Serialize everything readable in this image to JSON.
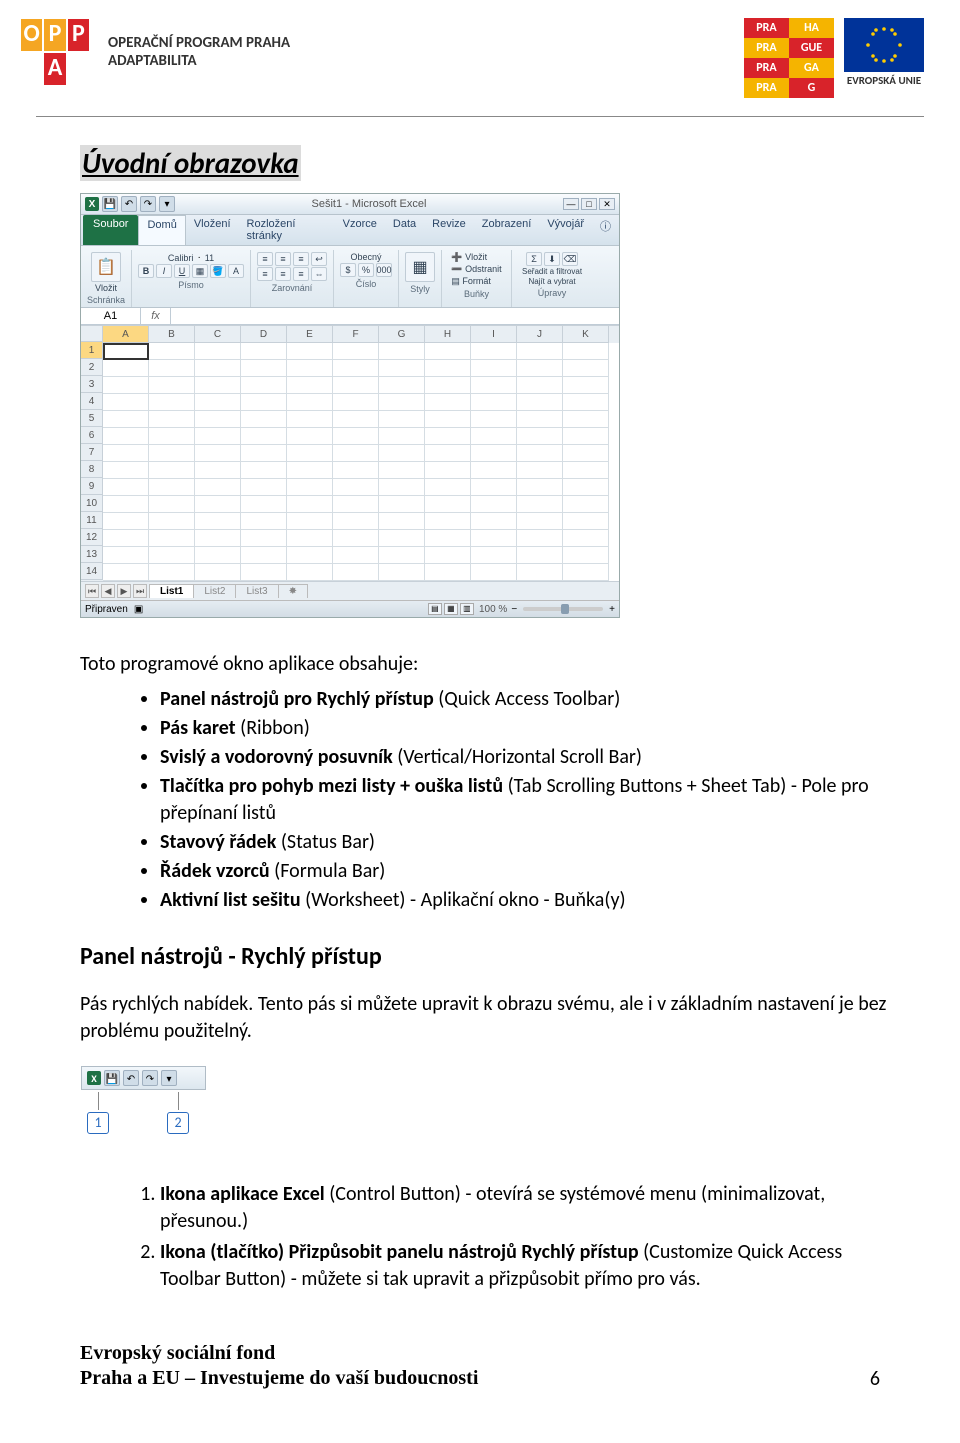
{
  "header": {
    "oppa_letters": [
      "O",
      "P",
      "P",
      "A"
    ],
    "oppa_text_line1": "OPERAČNÍ PROGRAM PRAHA",
    "oppa_text_line2": "ADAPTABILITA",
    "praha_cells": [
      "PRA",
      "HA",
      "PRA",
      "GUE",
      "PRA",
      "GA",
      "PRA",
      "G"
    ],
    "eu_label": "EVROPSKÁ UNIE"
  },
  "section_title": "Úvodní obrazovka",
  "excel": {
    "title": "Sešit1 - Microsoft Excel",
    "tabs": {
      "file": "Soubor",
      "list": [
        "Domů",
        "Vložení",
        "Rozložení stránky",
        "Vzorce",
        "Data",
        "Revize",
        "Zobrazení",
        "Vývojář"
      ]
    },
    "ribbon": {
      "paste": "Vložit",
      "clipboard_label": "Schránka",
      "font_name": "Calibri",
      "font_size": "11",
      "font_label": "Písmo",
      "align_label": "Zarovnání",
      "number_format": "Obecný",
      "number_label": "Číslo",
      "styles_label": "Styly",
      "insert_cell": "Vložit",
      "delete_cell": "Odstranit",
      "format_cell": "Formát",
      "cells_label": "Buňky",
      "sort": "Seřadit a filtrovat",
      "find": "Najít a vybrat",
      "edit_label": "Úpravy"
    },
    "namebox": "A1",
    "fx": "fx",
    "columns": [
      "A",
      "B",
      "C",
      "D",
      "E",
      "F",
      "G",
      "H",
      "I",
      "J",
      "K"
    ],
    "rows": [
      1,
      2,
      3,
      4,
      5,
      6,
      7,
      8,
      9,
      10,
      11,
      12,
      13,
      14
    ],
    "sheets": [
      "List1",
      "List2",
      "List3"
    ],
    "status_ready": "Připraven",
    "zoom": "100 %"
  },
  "intro": "Toto programové okno aplikace obsahuje:",
  "bullets": [
    {
      "bold": "Panel nástrojů pro Rychlý přístup",
      "rest": " (Quick Access Toolbar)"
    },
    {
      "bold": "Pás karet",
      "rest": " (Ribbon)"
    },
    {
      "bold": "Svislý a vodorovný posuvník",
      "rest": " (Vertical/Horizontal Scroll Bar)"
    },
    {
      "bold": "Tlačítka pro pohyb mezi listy + ouška listů",
      "rest": " (Tab Scrolling Buttons + Sheet Tab) - Pole pro přepínaní listů"
    },
    {
      "bold": "Stavový řádek",
      "rest": " (Status Bar)"
    },
    {
      "bold": "Řádek vzorců",
      "rest": " (Formula Bar)"
    },
    {
      "bold": "Aktivní list sešitu",
      "rest": " (Worksheet) - Aplikační okno - Buňka(y)"
    }
  ],
  "sub_heading": "Panel nástrojů - Rychlý přístup",
  "para": "Pás rychlých nabídek. Tento pás si můžete upravit k obrazu svému, ale i v základním nastavení je bez problému použitelný.",
  "callout_nums": [
    "1",
    "2"
  ],
  "numbered": [
    {
      "bold": "Ikona aplikace Excel",
      "rest": " (Control Button) - otevírá se systémové menu (minimalizovat, přesunou.)"
    },
    {
      "bold": "Ikona (tlačítko) Přizpůsobit panelu nástrojů Rychlý přístup",
      "rest": " (Customize Quick Access Toolbar Button) - můžete si tak upravit a přizpůsobit přímo pro vás."
    }
  ],
  "footer": {
    "line1": "Evropský sociální fond",
    "line2": "Praha a EU – Investujeme do vaší budoucnosti",
    "page": "6"
  },
  "colors": {
    "oppa_orange": "#f5a623",
    "oppa_red": "#d8232a",
    "praha_red": "#d8232a",
    "praha_yellow": "#f5b400",
    "eu_blue": "#003399"
  }
}
